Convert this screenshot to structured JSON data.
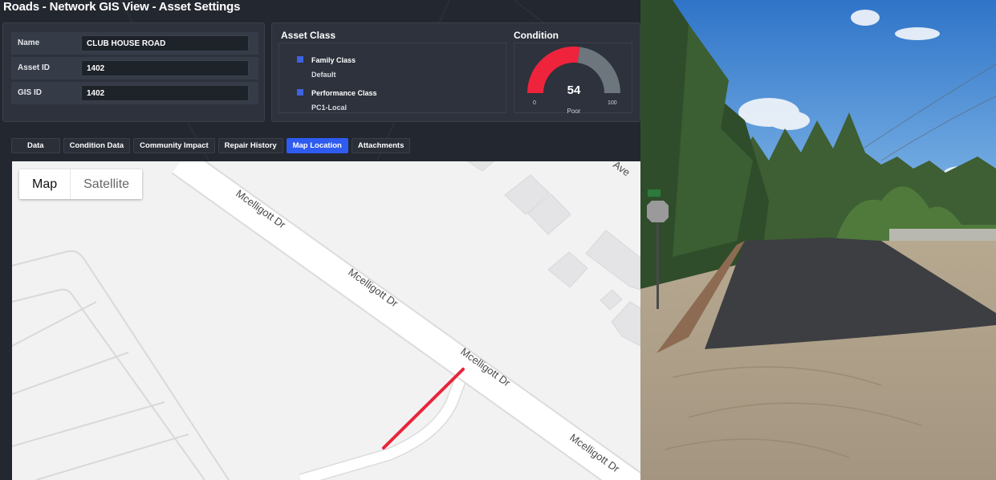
{
  "header": {
    "title": "Roads - Network GIS View - Asset Settings"
  },
  "info": {
    "fields": [
      {
        "label": "Name",
        "value": "CLUB HOUSE ROAD"
      },
      {
        "label": "Asset ID",
        "value": "1402"
      },
      {
        "label": "GIS ID",
        "value": "1402"
      }
    ]
  },
  "asset_class": {
    "title": "Asset Class",
    "items": [
      {
        "name": "Family Class",
        "value": "Default"
      },
      {
        "name": "Performance Class",
        "value": "PC1-Local"
      }
    ]
  },
  "condition": {
    "title": "Condition",
    "score": "54",
    "score_fraction": 0.54,
    "rating": "Poor",
    "min": "0",
    "max": "100",
    "color_good": "#ef233c",
    "color_rest": "#6d757d"
  },
  "tabs": [
    {
      "label": "Data",
      "active": false
    },
    {
      "label": "Condition Data",
      "active": false
    },
    {
      "label": "Community Impact",
      "active": false
    },
    {
      "label": "Repair History",
      "active": false
    },
    {
      "label": "Map Location",
      "active": true
    },
    {
      "label": "Attachments",
      "active": false
    }
  ],
  "map": {
    "toggle": {
      "map_label": "Map",
      "satellite_label": "Satellite"
    },
    "street_labels": [
      "Mcelligott Dr",
      "Mcelligott Dr",
      "Mcelligott Dr",
      "Mcelligott Dr"
    ],
    "corner_label": "Ave",
    "segment_color": "#e8253b"
  }
}
